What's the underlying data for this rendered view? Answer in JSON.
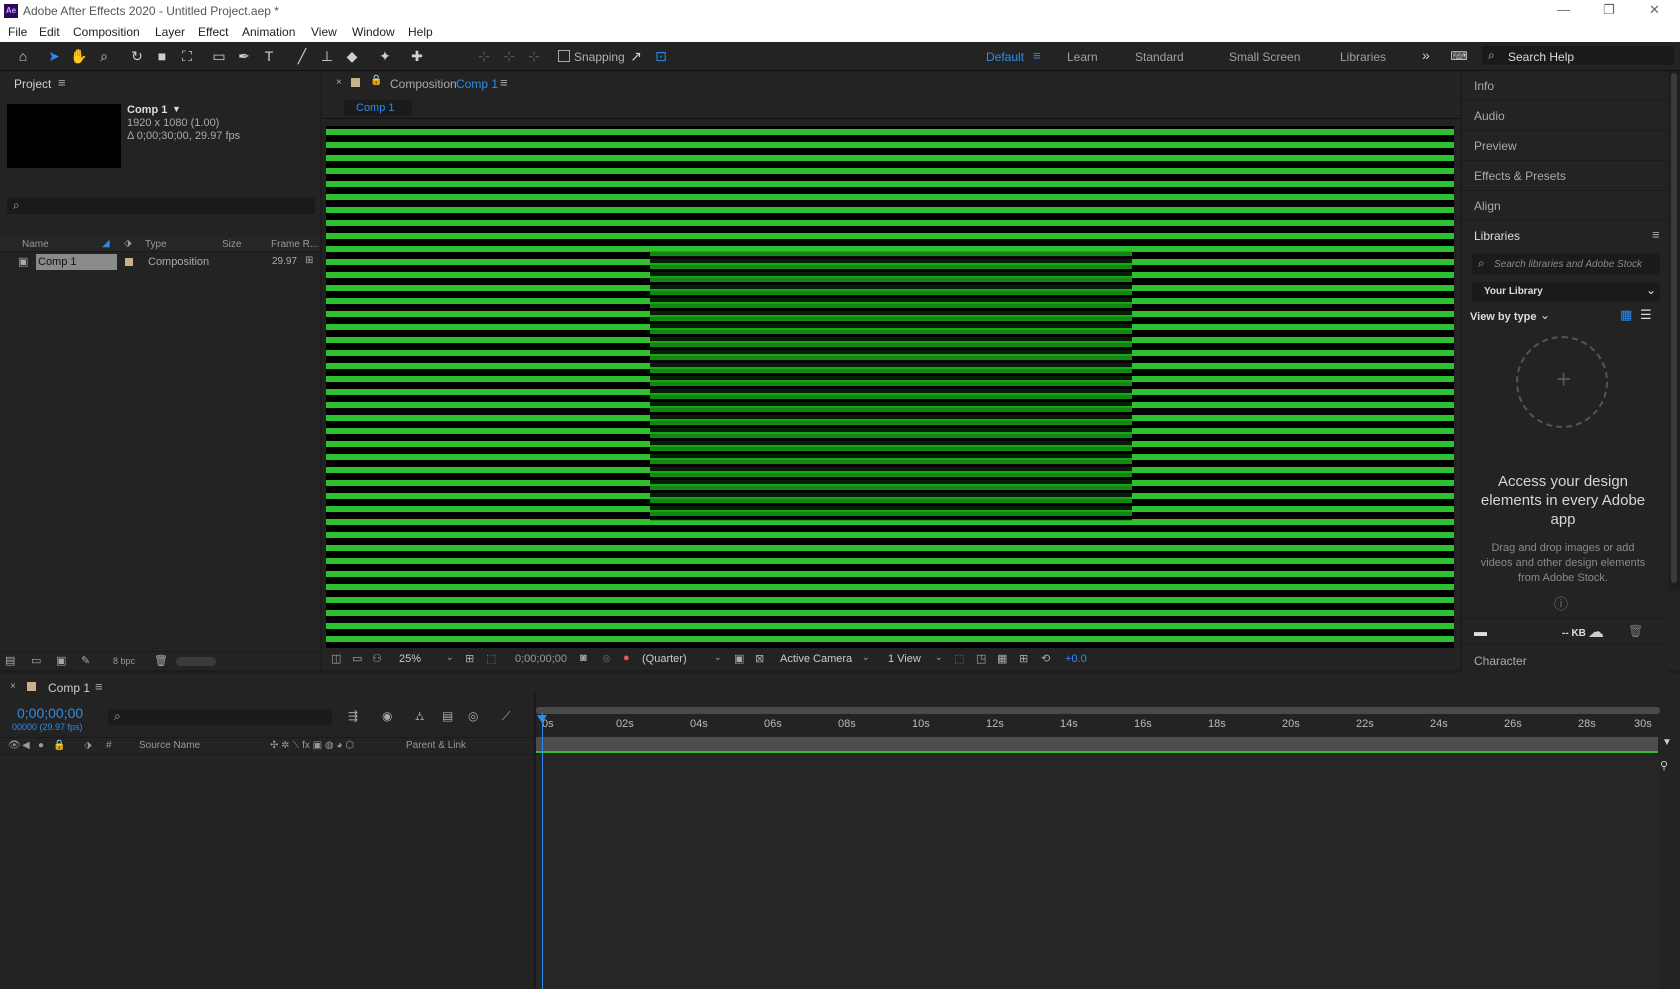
{
  "window": {
    "title": "Adobe After Effects 2020 - Untitled Project.aep *",
    "logo": "Ae"
  },
  "menu": [
    "File",
    "Edit",
    "Composition",
    "Layer",
    "Effect",
    "Animation",
    "View",
    "Window",
    "Help"
  ],
  "toolbar": {
    "snapping": "Snapping",
    "workspaces": [
      "Default",
      "Learn",
      "Standard",
      "Small Screen",
      "Libraries"
    ],
    "search_placeholder": "Search Help"
  },
  "project": {
    "tab": "Project",
    "comp_name": "Comp 1",
    "comp_res": "1920 x 1080 (1.00)",
    "comp_dur": "Δ 0;00;30;00, 29.97 fps",
    "columns": [
      "Name",
      "Type",
      "Size",
      "Frame R..."
    ],
    "items": [
      {
        "name": "Comp 1",
        "type": "Composition",
        "fps": "29.97"
      }
    ],
    "bpc": "8 bpc"
  },
  "composition": {
    "tab_prefix": "Composition",
    "tab_name": "Comp 1",
    "subtab": "Comp 1",
    "zoom": "25%",
    "timecode": "0;00;00;00",
    "resolution": "(Quarter)",
    "camera": "Active Camera",
    "views": "1 View",
    "exposure": "+0.0"
  },
  "right_panels": [
    "Info",
    "Audio",
    "Preview",
    "Effects & Presets",
    "Align"
  ],
  "libraries": {
    "title": "Libraries",
    "search_placeholder": "Search libraries and Adobe Stock",
    "library": "Your Library",
    "view_by": "View by type",
    "heading": "Access your design elements in every Adobe app",
    "body": "Drag and drop images or add videos and other design elements from Adobe Stock.",
    "size": "-- KB",
    "character": "Character"
  },
  "timeline": {
    "tab": "Comp 1",
    "timecode": "0;00;00;00",
    "frames": "00000 (29.97 fps)",
    "columns": {
      "num": "#",
      "source": "Source Name",
      "parent": "Parent & Link"
    },
    "ruler": [
      "0s",
      "02s",
      "04s",
      "06s",
      "08s",
      "10s",
      "12s",
      "14s",
      "16s",
      "18s",
      "20s",
      "22s",
      "24s",
      "26s",
      "28s",
      "30s"
    ]
  },
  "colors": {
    "accent": "#2d8ceb",
    "stripe": "#2fc02f",
    "stripe_dark": "#14a014"
  }
}
